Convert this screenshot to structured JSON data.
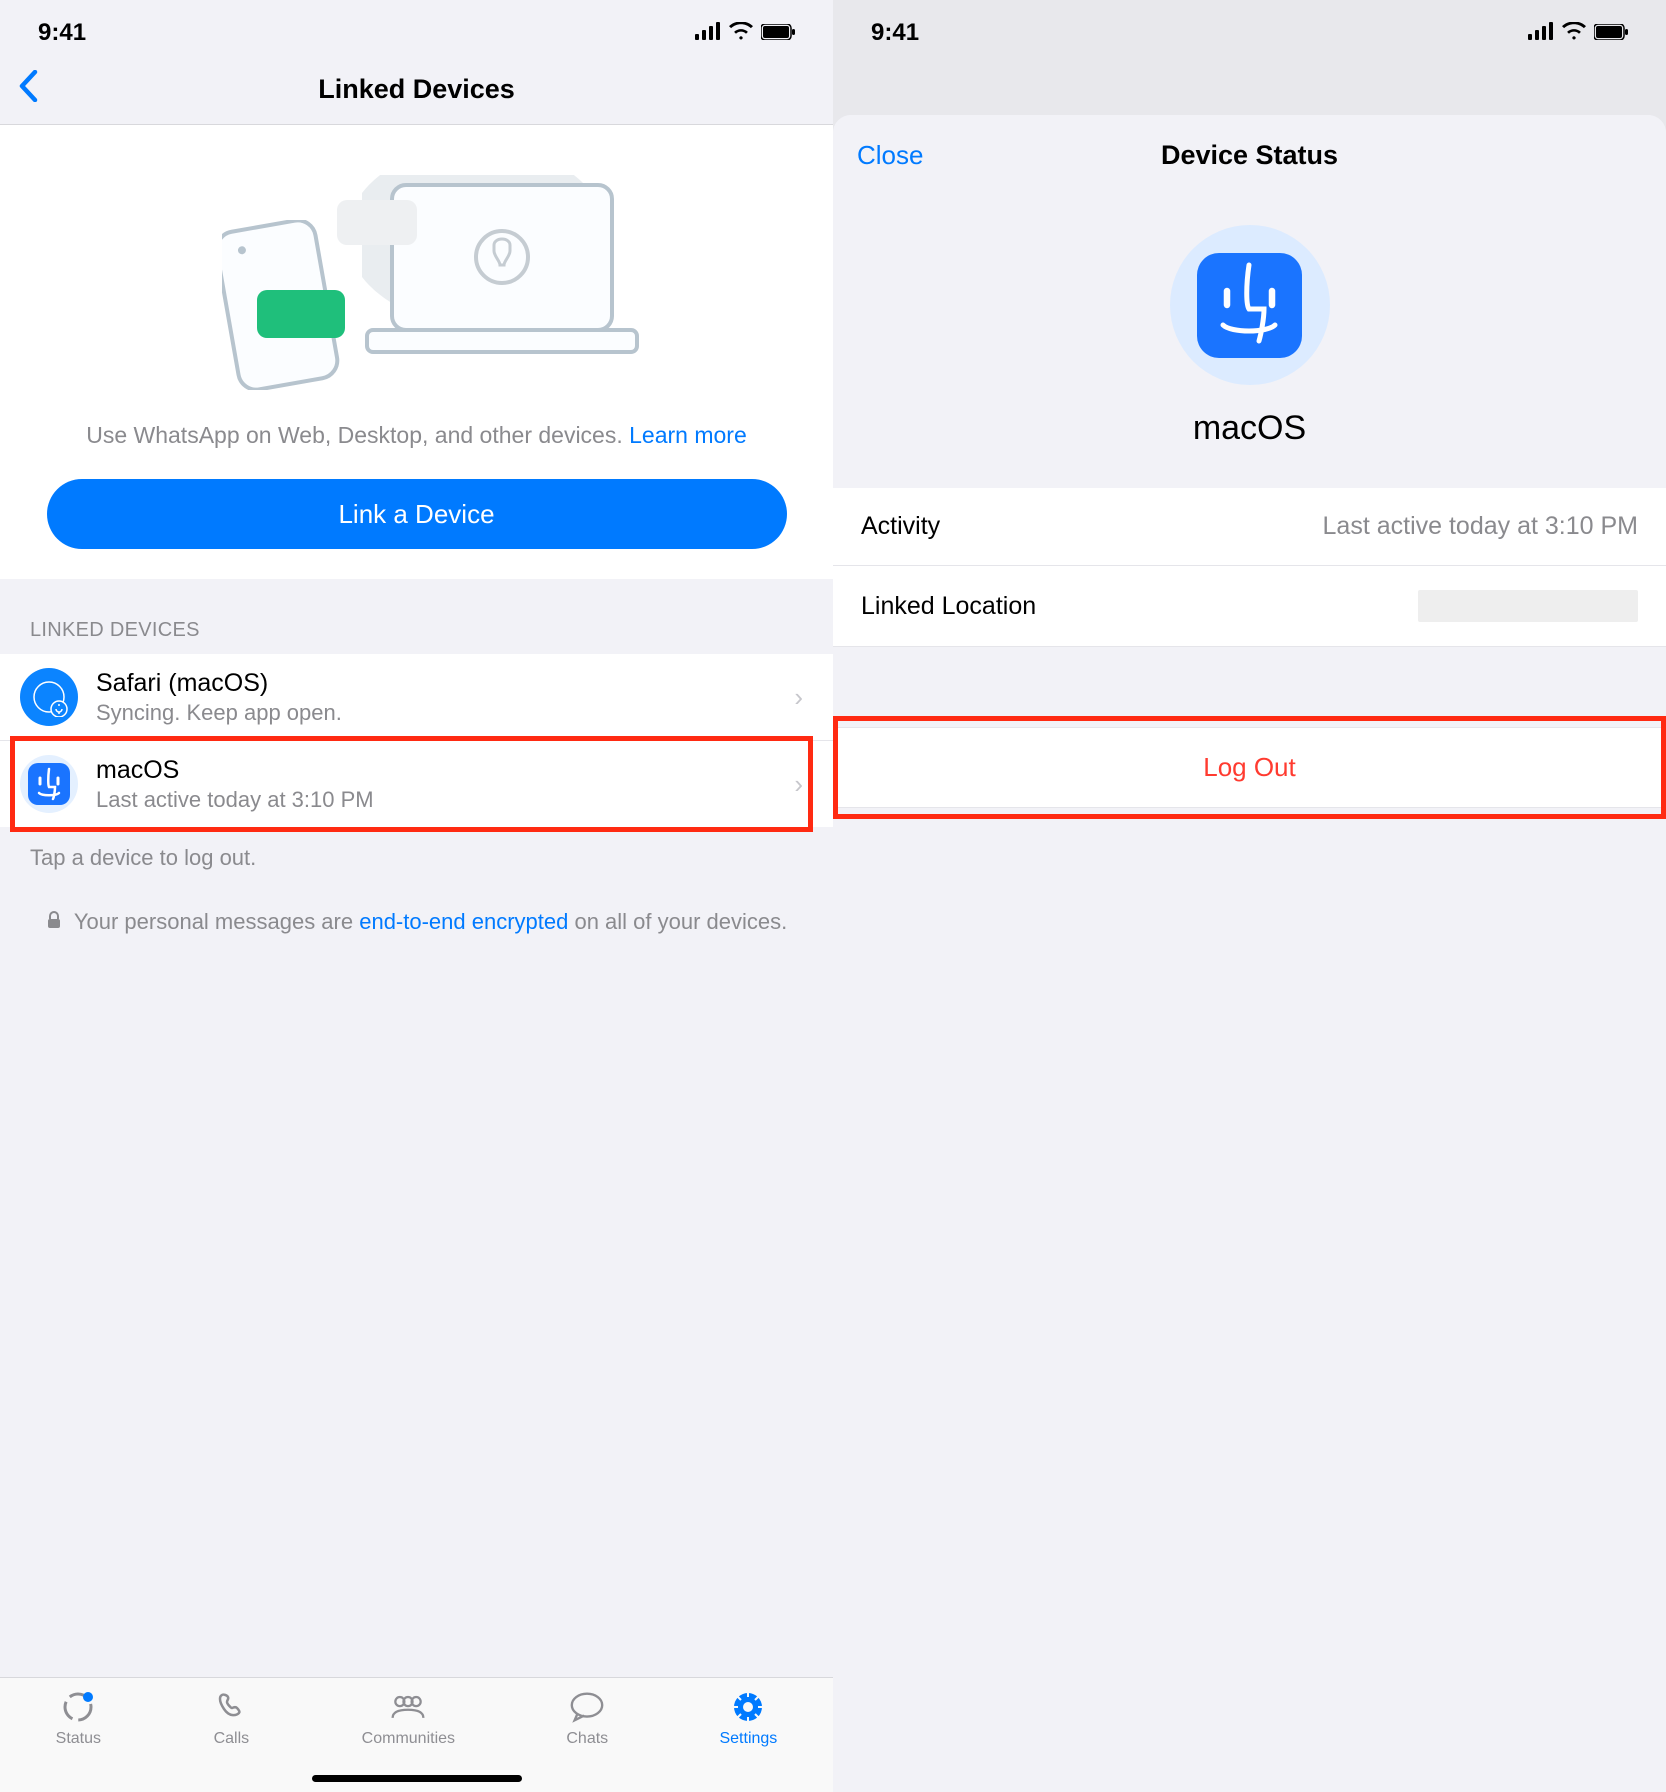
{
  "status": {
    "time": "9:41"
  },
  "left": {
    "nav_title": "Linked Devices",
    "hero_text_pre": "Use WhatsApp on Web, Desktop, and other devices. ",
    "hero_learn_more": "Learn more",
    "link_button": "Link a Device",
    "section_header": "LINKED DEVICES",
    "devices": [
      {
        "title": "Safari (macOS)",
        "subtitle": "Syncing. Keep app open."
      },
      {
        "title": "macOS",
        "subtitle": "Last active today at 3:10 PM"
      }
    ],
    "tap_note": "Tap a device to log out.",
    "encryption_pre": "Your personal messages are ",
    "encryption_link": "end-to-end encrypted",
    "encryption_post": " on all of your devices.",
    "tabs": [
      {
        "label": "Status"
      },
      {
        "label": "Calls"
      },
      {
        "label": "Communities"
      },
      {
        "label": "Chats"
      },
      {
        "label": "Settings"
      }
    ]
  },
  "right": {
    "close": "Close",
    "title": "Device Status",
    "device_name": "macOS",
    "rows": [
      {
        "label": "Activity",
        "value": "Last active today at 3:10 PM"
      },
      {
        "label": "Linked Location",
        "value": ""
      }
    ],
    "logout": "Log Out"
  },
  "colors": {
    "accent": "#007aff",
    "destructive": "#ff3b30",
    "highlight": "#ff2a12"
  }
}
